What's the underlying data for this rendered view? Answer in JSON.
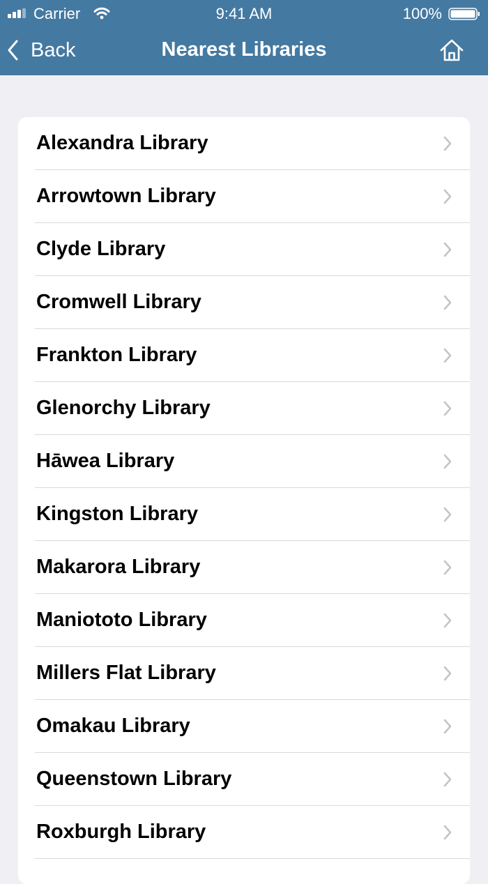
{
  "status_bar": {
    "carrier": "Carrier",
    "time": "9:41 AM",
    "battery": "100%",
    "icons": [
      "signal-bars-icon",
      "wifi-icon",
      "battery-icon"
    ]
  },
  "nav": {
    "back_label": "Back",
    "title": "Nearest Libraries",
    "back_icon": "chevron-left-icon",
    "home_icon": "home-icon"
  },
  "colors": {
    "nav_background": "#4479a1",
    "page_background": "#efeff4",
    "row_text": "#000000",
    "disclosure_chevron": "#c4c4c7"
  },
  "libraries": [
    {
      "name": "Alexandra Library"
    },
    {
      "name": "Arrowtown Library"
    },
    {
      "name": "Clyde Library"
    },
    {
      "name": "Cromwell Library"
    },
    {
      "name": "Frankton Library"
    },
    {
      "name": "Glenorchy Library"
    },
    {
      "name": "Hāwea Library"
    },
    {
      "name": "Kingston Library"
    },
    {
      "name": "Makarora Library"
    },
    {
      "name": "Maniototo Library"
    },
    {
      "name": "Millers Flat Library"
    },
    {
      "name": "Omakau Library"
    },
    {
      "name": "Queenstown Library"
    },
    {
      "name": "Roxburgh Library"
    }
  ]
}
